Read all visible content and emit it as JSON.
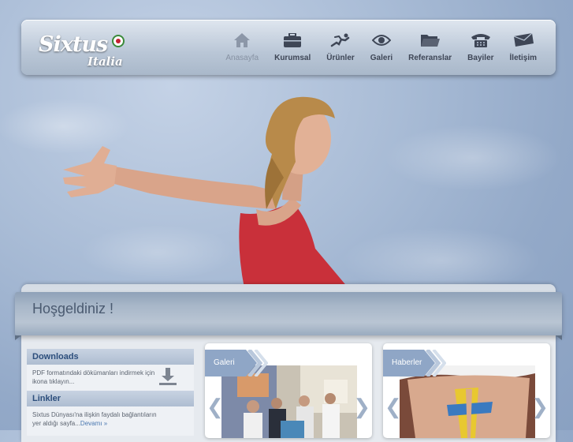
{
  "header": {
    "logo": {
      "brand": "Sixtus",
      "sub": "Italia"
    },
    "nav": [
      {
        "label": "Anasayfa",
        "icon": "home-icon",
        "active": true
      },
      {
        "label": "Kurumsal",
        "icon": "briefcase-icon",
        "active": false
      },
      {
        "label": "Ürünler",
        "icon": "runner-icon",
        "active": false
      },
      {
        "label": "Galeri",
        "icon": "eye-icon",
        "active": false
      },
      {
        "label": "Referanslar",
        "icon": "folder-icon",
        "active": false
      },
      {
        "label": "Bayiler",
        "icon": "phone-icon",
        "active": false
      },
      {
        "label": "İletişim",
        "icon": "envelope-icon",
        "active": false
      }
    ]
  },
  "welcome": {
    "title": "Hoşgeldiniz !"
  },
  "sidebar": {
    "downloads": {
      "title": "Downloads",
      "text": "PDF formatındaki dökümanları indirmek için ikona tıklayın..."
    },
    "links": {
      "title": "Linkler",
      "text": "Sixtus Dünyası'na ilişkin faydalı bağlantıların yer aldığı sayfa...",
      "more": "Devamı »"
    }
  },
  "cards": {
    "gallery": {
      "title": "Galeri"
    },
    "news": {
      "title": "Haberler"
    }
  },
  "colors": {
    "accent": "#2c4e7c",
    "tag": "#8fa6c6",
    "nav_text": "#3e4656"
  }
}
